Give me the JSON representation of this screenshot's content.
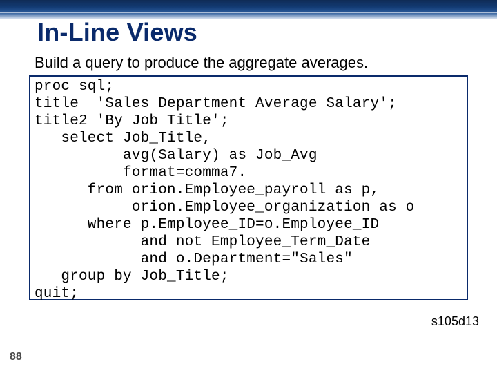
{
  "header": {
    "title": "In-Line Views",
    "subtitle": "Build a query to produce the aggregate averages."
  },
  "code": {
    "text": "proc sql;\ntitle  'Sales Department Average Salary';\ntitle2 'By Job Title';\n   select Job_Title,\n          avg(Salary) as Job_Avg\n          format=comma7.\n      from orion.Employee_payroll as p,\n           orion.Employee_organization as o\n      where p.Employee_ID=o.Employee_ID\n            and not Employee_Term_Date\n            and o.Department=\"Sales\"\n   group by Job_Title;\nquit;"
  },
  "footer": {
    "page": "88",
    "ref": "s105d13"
  }
}
